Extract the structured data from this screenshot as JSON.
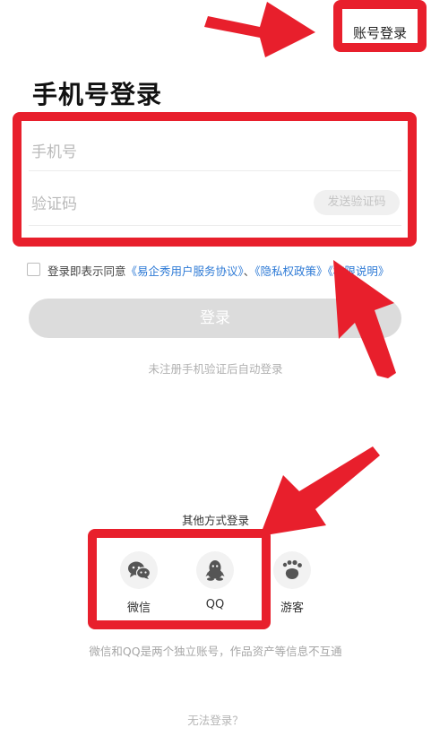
{
  "header": {
    "account_login_label": "账号登录"
  },
  "title": "手机号登录",
  "form": {
    "phone_placeholder": "手机号",
    "code_placeholder": "验证码",
    "send_code_label": "发送验证码"
  },
  "agreement": {
    "prefix": "登录即表示同意",
    "user_agreement": "《易企秀用户服务协议》",
    "separator": "、",
    "privacy_policy": "《隐私权政策》",
    "permission_note": "《权限说明》"
  },
  "login_button": "登录",
  "auto_register_hint": "未注册手机验证后自动登录",
  "other_methods": {
    "title": "其他方式登录",
    "options": [
      {
        "label": "微信",
        "icon": "wechat-icon"
      },
      {
        "label": "QQ",
        "icon": "qq-icon"
      },
      {
        "label": "游客",
        "icon": "footprint-icon"
      }
    ],
    "note": "微信和QQ是两个独立账号，作品资产等信息不互通"
  },
  "cannot_login": "无法登录？",
  "colors": {
    "annotation_red": "#e81f2c",
    "link_blue": "#2f7bd6",
    "button_disabled": "#dcdcdc"
  }
}
